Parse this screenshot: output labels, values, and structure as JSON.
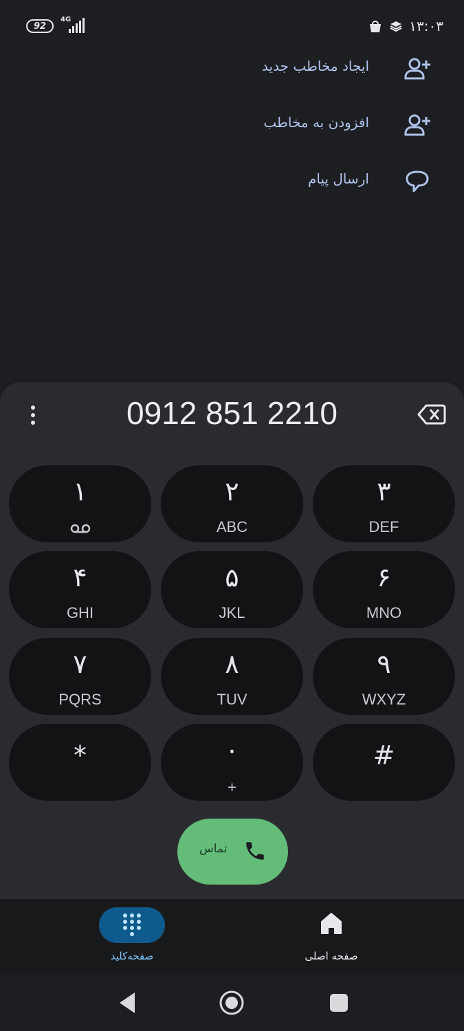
{
  "status_bar": {
    "battery": "92",
    "network": "4G",
    "time": "۱۳:۰۳"
  },
  "actions": [
    {
      "label": "ایجاد مخاطب جدید",
      "icon": "add-person-icon"
    },
    {
      "label": "افزودن به مخاطب",
      "icon": "add-person-icon"
    },
    {
      "label": "ارسال پیام",
      "icon": "message-icon"
    }
  ],
  "dialer": {
    "number": "0912 851 2210",
    "keys": [
      {
        "digit": "۱",
        "letters": ""
      },
      {
        "digit": "۲",
        "letters": "ABC"
      },
      {
        "digit": "۳",
        "letters": "DEF"
      },
      {
        "digit": "۴",
        "letters": "GHI"
      },
      {
        "digit": "۵",
        "letters": "JKL"
      },
      {
        "digit": "۶",
        "letters": "MNO"
      },
      {
        "digit": "۷",
        "letters": "PQRS"
      },
      {
        "digit": "۸",
        "letters": "TUV"
      },
      {
        "digit": "۹",
        "letters": "WXYZ"
      },
      {
        "digit": "*",
        "letters": ""
      },
      {
        "digit": "۰",
        "letters": "+"
      },
      {
        "digit": "#",
        "letters": ""
      }
    ],
    "call_label": "تماس"
  },
  "bottom_nav": {
    "dialpad_label": "صفحه‌کلید",
    "home_label": "صفحه اصلی",
    "active_color": "#0e5a8c",
    "active_text_color": "#7cc2f5"
  }
}
